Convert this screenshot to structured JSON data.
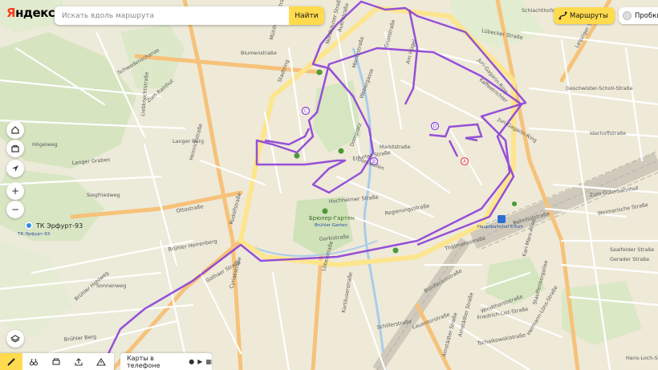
{
  "header": {
    "logo": "Яндекс",
    "search_placeholder": "Искать вдоль маршрута",
    "search_button": "Найти",
    "route_button": "Маршруты",
    "traffic_button": "Пробки"
  },
  "bottom": {
    "app_label": "Карты в телефоне"
  },
  "poi": {
    "tk_label": "ТК Эрфурт-93",
    "tk_sub": "ТК-Эрфурт-93",
    "garden": "Брюлер-Гартен",
    "garden_sub": "Brühler Garten",
    "station": "Hauptbahnhof Erfurt"
  },
  "markers": [
    "A",
    "B",
    "C",
    "D"
  ],
  "streets": [
    "Blumenstraße",
    "Mühlhäuser Straße",
    "Stadtring",
    "Nordhäuser Straße",
    "Auenstraße",
    "Moritzstraße",
    "Webergasse",
    "Regierungsstraße",
    "Marktstraße",
    "Domplatz",
    "Domstufen",
    "Hochheimer Straße",
    "Brühler Hohlweg",
    "Gothaer Straße",
    "Gorkistraße",
    "Löberstraße",
    "Schillerstraße",
    "Arnstädter Straße",
    "Karl-Marx-Allee",
    "Stauffenbergallee",
    "Leipziger Straße",
    "Juri-Gagarin-Ring",
    "Bahnhofstraße",
    "Thälmannstraße",
    "Kaffeetrichter",
    "Schlachthofstraße",
    "Lübecker Straße",
    "Geschwister-Scholl-Straße",
    "Iderhoffstraße",
    "Weimarische Straße",
    "Zum Güterbahnhof",
    "Saalfelder Straße",
    "Gerader Straße",
    "Hans-Loch-Straße",
    "Cyriakstraße",
    "Heinrichstraße",
    "Rudolfstraße",
    "Liebknechtstraße",
    "Hermann-Löns-Straße",
    "Windthorststraße",
    "Bonifaciusstraße",
    "Lauentorstraße",
    "Friedrich-List-Straße",
    "Tschaikowskistraße",
    "Erfurter Straße",
    "Siegfriedweg",
    "Ottostraße",
    "Brühler Herrenberg",
    "Sonnenweg",
    "Brühler Berg",
    "Langer Graben",
    "Zum Rainhut",
    "Schwedenschanze",
    "Högelweg",
    "Langer Berg",
    "Arnstädter Straße",
    "Juri-Gagarin-Ring",
    "Grünstraße",
    "Am Hügel",
    "Kartäuserstraße"
  ]
}
